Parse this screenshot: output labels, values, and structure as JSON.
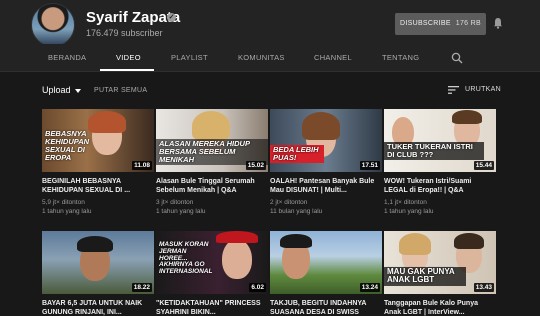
{
  "channel": {
    "name": "Syarif Zapata",
    "subscribers": "176.479 subscriber",
    "subscribe_label": "DISUBSCRIBE",
    "subscribe_count": "176 RB"
  },
  "tabs": [
    "BERANDA",
    "VIDEO",
    "PLAYLIST",
    "KOMUNITAS",
    "CHANNEL",
    "TENTANG"
  ],
  "active_tab": "VIDEO",
  "toolbar": {
    "upload_label": "Upload",
    "play_all_label": "PUTAR SEMUA",
    "sort_label": "URUTKAN"
  },
  "videos": [
    {
      "title": "BEGINILAH BEBASNYA KEHIDUPAN SEXUAL DI ...",
      "views": "5,9 jt× ditonton",
      "age": "1 tahun yang lalu",
      "duration": "11.08",
      "caption": "BEBASNYA KEHIDUPAN SEXUAL DI EROPA"
    },
    {
      "title": "Alasan Bule Tinggal Serumah Sebelum Menikah | Q&A",
      "views": "3 jt× ditonton",
      "age": "1 tahun yang lalu",
      "duration": "15.02",
      "caption": "ALASAN MEREKA HIDUP BERSAMA SEBELUM MENIKAH"
    },
    {
      "title": "OALAH! Pantesan Banyak Bule Mau DISUNAT! | Multi...",
      "views": "2 jt× ditonton",
      "age": "11 bulan yang lalu",
      "duration": "17.51",
      "caption": "BEDA LEBIH PUAS!"
    },
    {
      "title": "WOW! Tukeran Istri/Suami LEGAL di Eropa!! | Q&A",
      "views": "1,1 jt× ditonton",
      "age": "1 tahun yang lalu",
      "duration": "15.44",
      "caption": "TUKER TUKERAN ISTRI DI CLUB ???"
    },
    {
      "title": "BAYAR 6,5 JUTA UNTUK NAIK GUNUNG RINJANI, INI...",
      "views": "",
      "age": "",
      "duration": "18.22",
      "caption": ""
    },
    {
      "title": "\"KETIDAKTAHUAN\" PRINCESS SYAHRINI BIKIN...",
      "views": "",
      "age": "",
      "duration": "6.02",
      "caption": "MASUK KORAN JERMAN HOREE... AKHIRNYA GO INTERNASIONAL"
    },
    {
      "title": "TAKJUB, BEGITU INDAHNYA SUASANA DESA DI SWISS",
      "views": "",
      "age": "",
      "duration": "13.24",
      "caption": ""
    },
    {
      "title": "Tanggapan Bule Kalo Punya Anak LGBT | InterView...",
      "views": "",
      "age": "",
      "duration": "13.43",
      "caption": "MAU GAK PUNYA ANAK LGBT"
    }
  ]
}
